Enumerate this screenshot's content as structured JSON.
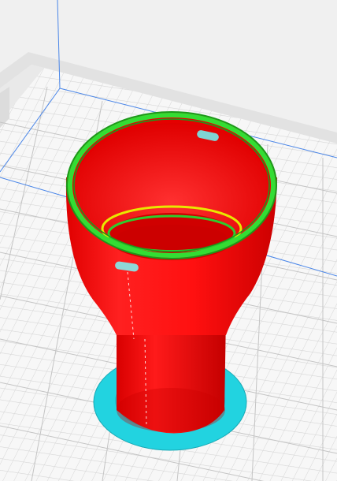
{
  "viewport": {
    "background": "#f0f0f0",
    "grid_color": "#c8c8c8",
    "grid_minor_color": "#dcdcdc",
    "axis_color": "#4a86e8",
    "bed_edge_color": "#dedede"
  },
  "model": {
    "colors": {
      "outer_wall": "#ff1a1a",
      "outer_wall_dark": "#d40000",
      "inner_wall": "#ff0000",
      "top_skin": "#2ecc2e",
      "top_skin_dark": "#1a9a1a",
      "inner_ring": "#e8e800",
      "skirt_brim": "#22d3e0",
      "support_marker": "#7fd4d4",
      "seam": "#ffffff"
    }
  }
}
